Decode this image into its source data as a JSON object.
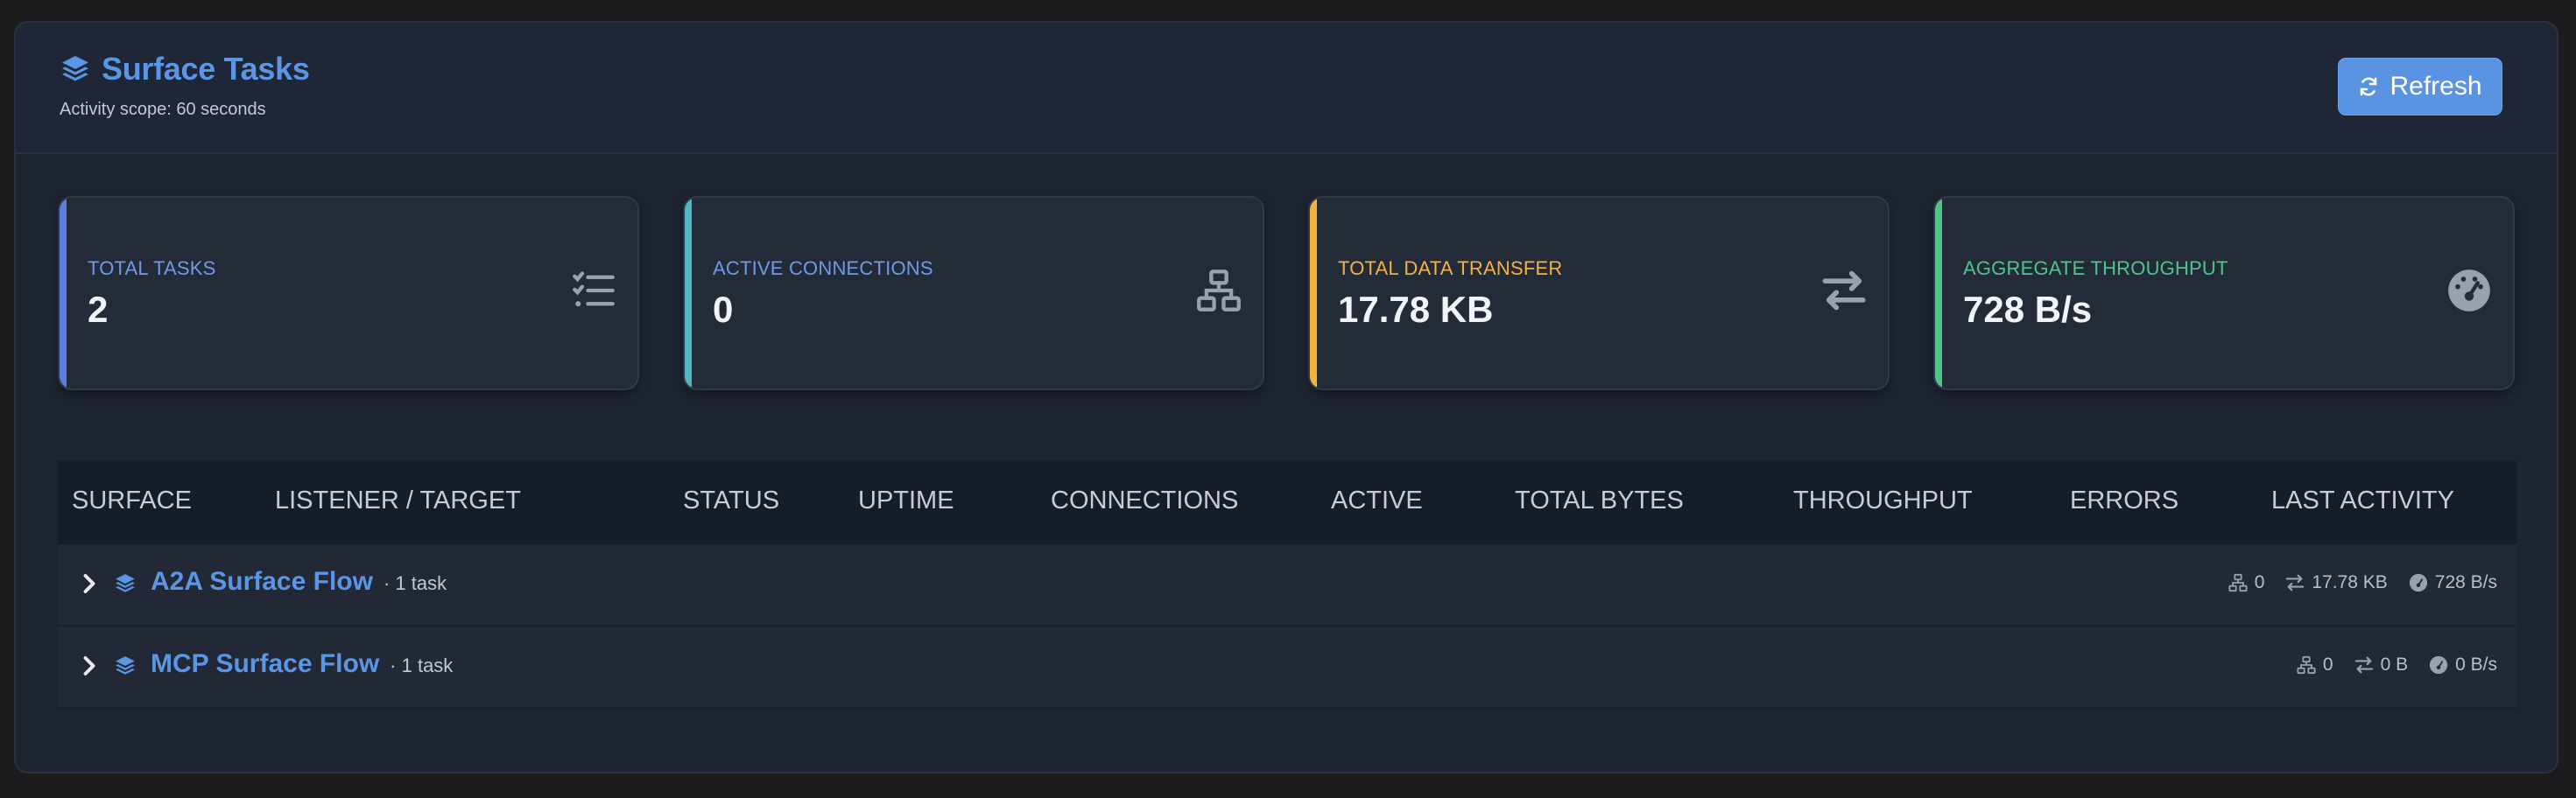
{
  "header": {
    "title": "Surface Tasks",
    "subtitle": "Activity scope: 60 seconds",
    "refresh_label": "Refresh"
  },
  "cards": [
    {
      "label": "Total Tasks",
      "value": "2",
      "color": "#5b7fe0",
      "icon": "tasks-icon"
    },
    {
      "label": "Active Connections",
      "value": "0",
      "color": "#4fb6c2",
      "icon": "network-icon"
    },
    {
      "label": "Total Data Transfer",
      "value": "17.78 KB",
      "color": "#f2b440",
      "icon": "exchange-icon"
    },
    {
      "label": "Aggregate Throughput",
      "value": "728 B/s",
      "color": "#4fc58a",
      "icon": "gauge-icon"
    }
  ],
  "table": {
    "columns": [
      "Surface",
      "Listener / Target",
      "Status",
      "Uptime",
      "Connections",
      "Active",
      "Total Bytes",
      "Throughput",
      "Errors",
      "Last Activity"
    ],
    "groups": [
      {
        "name": "A2A Surface Flow",
        "count": "· 1 task",
        "connections": "0",
        "bytes": "17.78 KB",
        "throughput": "728 B/s"
      },
      {
        "name": "MCP Surface Flow",
        "count": "· 1 task",
        "connections": "0",
        "bytes": "0 B",
        "throughput": "0 B/s"
      }
    ]
  }
}
